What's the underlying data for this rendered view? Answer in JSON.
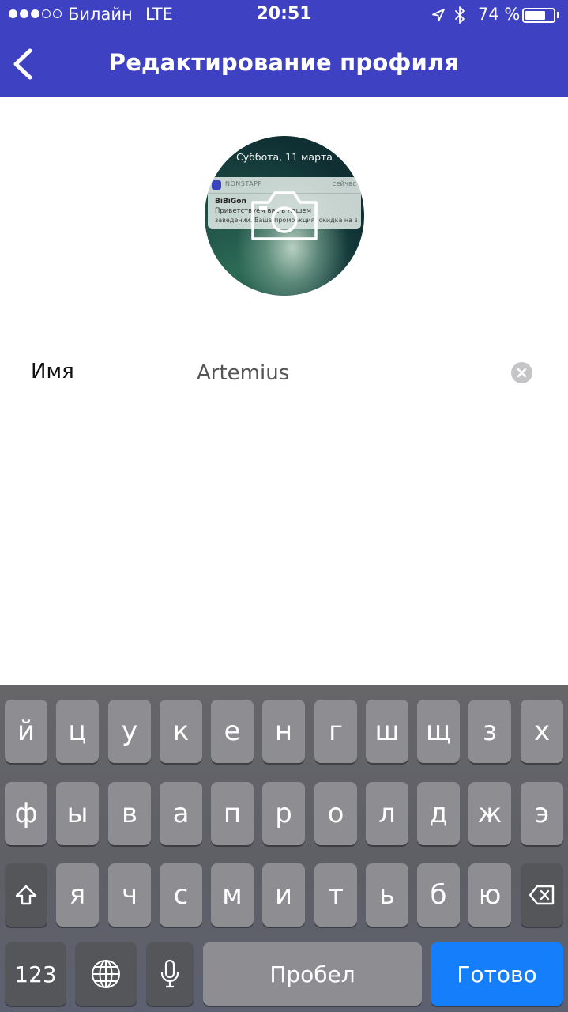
{
  "status_bar": {
    "carrier": "Билайн",
    "network": "LTE",
    "time": "20:51",
    "battery_percent": "74 %",
    "battery_level": 0.74,
    "signal_bars_filled": 3,
    "signal_bars_total": 5
  },
  "header": {
    "title": "Редактирование профиля",
    "back_icon": "chevron-left-icon",
    "background_color": "#3d41c2"
  },
  "avatar": {
    "date_text": "Суббота, 11 марта",
    "notification": {
      "app_name": "NONSTAPP",
      "time": "сейчас",
      "title": "BiBiGon",
      "line1": "Приветствуем вас в нашем",
      "line2": "заведении. Ваша промоакция: скидка на весь..."
    },
    "overlay_icon": "camera-icon"
  },
  "form": {
    "name_label": "Имя",
    "name_value": "Artemius"
  },
  "keyboard": {
    "row1": [
      "й",
      "ц",
      "у",
      "к",
      "е",
      "н",
      "г",
      "ш",
      "щ",
      "з",
      "х"
    ],
    "row2": [
      "ф",
      "ы",
      "в",
      "а",
      "п",
      "р",
      "о",
      "л",
      "д",
      "ж",
      "э"
    ],
    "row3": [
      "я",
      "ч",
      "с",
      "м",
      "и",
      "т",
      "ь",
      "б",
      "ю"
    ],
    "numbers_label": "123",
    "space_label": "Пробел",
    "done_label": "Готово",
    "done_color": "#157efb"
  }
}
